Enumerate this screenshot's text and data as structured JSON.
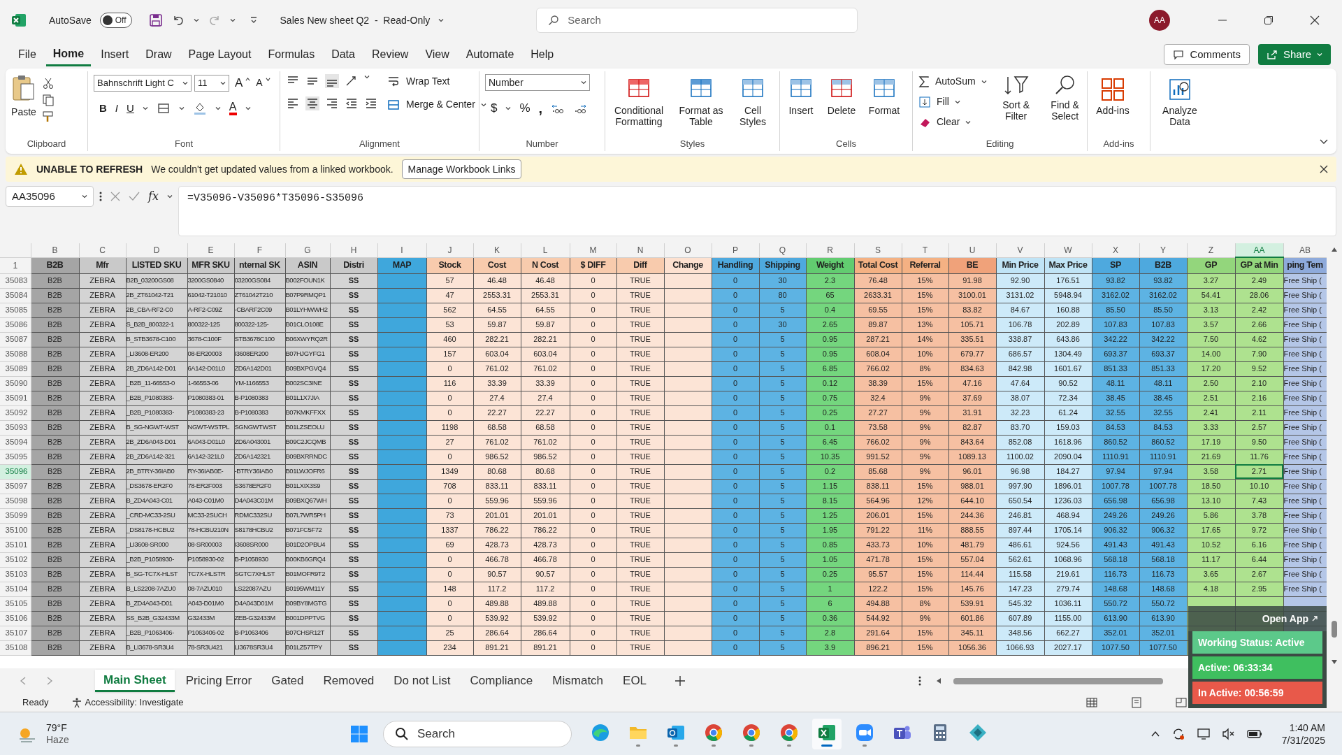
{
  "title_bar": {
    "autosave_label": "AutoSave",
    "autosave": {
      "on": false,
      "label": "Off"
    },
    "document_title": "Sales New sheet Q2  -  Read-Only",
    "search_placeholder": "Search",
    "avatar": "AA"
  },
  "menu_tabs": [
    {
      "label": "File",
      "selected": false
    },
    {
      "label": "Home",
      "selected": true
    },
    {
      "label": "Insert",
      "selected": false
    },
    {
      "label": "Draw",
      "selected": false
    },
    {
      "label": "Page Layout",
      "selected": false
    },
    {
      "label": "Formulas",
      "selected": false
    },
    {
      "label": "Data",
      "selected": false
    },
    {
      "label": "Review",
      "selected": false
    },
    {
      "label": "View",
      "selected": false
    },
    {
      "label": "Automate",
      "selected": false
    },
    {
      "label": "Help",
      "selected": false
    }
  ],
  "comments_button": "Comments",
  "share_button": "Share",
  "ribbon": {
    "clipboard": {
      "paste": "Paste",
      "group": "Clipboard"
    },
    "font": {
      "font_name": "Bahnschrift Light C",
      "font_size": "11",
      "grow": "A",
      "shrink": "A",
      "bold": "B",
      "italic": "I",
      "underline": "U",
      "font_color": "A",
      "group": "Font"
    },
    "alignment": {
      "wrap": "Wrap Text",
      "merge": "Merge & Center",
      "group": "Alignment"
    },
    "number": {
      "format": "Number",
      "currency": "$",
      "percent": "%",
      "comma": ",",
      "group": "Number"
    },
    "styles": {
      "conditional": "Conditional Formatting",
      "table": "Format as Table",
      "cell_styles": "Cell Styles",
      "group": "Styles"
    },
    "cells": {
      "insert": "Insert",
      "delete": "Delete",
      "format": "Format",
      "group": "Cells"
    },
    "editing": {
      "autosum": "AutoSum",
      "fill": "Fill",
      "clear": "Clear",
      "sort": "Sort & Filter",
      "find": "Find & Select",
      "group": "Editing"
    },
    "addins": {
      "addins": "Add-ins",
      "analyze": "Analyze Data",
      "group": "Add-ins"
    }
  },
  "message_bar": {
    "title": "UNABLE TO REFRESH",
    "text": "We couldn't get updated values from a linked workbook.",
    "button": "Manage Workbook Links"
  },
  "formula_bar": {
    "name_box": "AA35096",
    "function_label": "fx",
    "formula": "=V35096-V35096*T35096-S35096"
  },
  "sheet": {
    "columns": [
      {
        "letter": "B",
        "header": "B2B",
        "kind": "key",
        "selected": false
      },
      {
        "letter": "C",
        "header": "Mfr",
        "kind": "info",
        "selected": false
      },
      {
        "letter": "D",
        "header": "LISTED SKU",
        "kind": "info",
        "selected": false
      },
      {
        "letter": "E",
        "header": "MFR SKU",
        "kind": "info",
        "selected": false
      },
      {
        "letter": "F",
        "header": "nternal SK",
        "kind": "info",
        "selected": false
      },
      {
        "letter": "G",
        "header": "ASIN",
        "kind": "info",
        "selected": false
      },
      {
        "letter": "H",
        "header": "Distri",
        "kind": "info",
        "selected": false
      },
      {
        "letter": "I",
        "header": "MAP",
        "kind": "map",
        "selected": false
      },
      {
        "letter": "J",
        "header": "Stock",
        "kind": "cost",
        "selected": false
      },
      {
        "letter": "K",
        "header": "Cost",
        "kind": "cost",
        "selected": false
      },
      {
        "letter": "L",
        "header": "N Cost",
        "kind": "cost",
        "selected": false
      },
      {
        "letter": "M",
        "header": "$ DIFF",
        "kind": "cost",
        "selected": false
      },
      {
        "letter": "N",
        "header": "Diff",
        "kind": "cost",
        "selected": false
      },
      {
        "letter": "O",
        "header": "Change",
        "kind": "change",
        "selected": false
      },
      {
        "letter": "P",
        "header": "Handling",
        "kind": "ship",
        "selected": false
      },
      {
        "letter": "Q",
        "header": "Shipping",
        "kind": "ship",
        "selected": false
      },
      {
        "letter": "R",
        "header": "Weight",
        "kind": "weight",
        "selected": false
      },
      {
        "letter": "S",
        "header": "Total Cost",
        "kind": "total",
        "selected": false
      },
      {
        "letter": "T",
        "header": "Referral",
        "kind": "total",
        "selected": false
      },
      {
        "letter": "U",
        "header": "BE",
        "kind": "be",
        "selected": false
      },
      {
        "letter": "V",
        "header": "Min Price",
        "kind": "price",
        "selected": false
      },
      {
        "letter": "W",
        "header": "Max Price",
        "kind": "price",
        "selected": false
      },
      {
        "letter": "X",
        "header": "SP",
        "kind": "sp",
        "selected": false
      },
      {
        "letter": "Y",
        "header": "B2B",
        "kind": "sp",
        "selected": false
      },
      {
        "letter": "Z",
        "header": "GP",
        "kind": "gp",
        "selected": false
      },
      {
        "letter": "AA",
        "header": "GP at Min",
        "kind": "gp",
        "selected": true
      },
      {
        "letter": "AB",
        "header": "ping Tem",
        "kind": "template",
        "selected": false
      }
    ],
    "header_row_number": "1",
    "rows": [
      {
        "number": "35083",
        "selected": false,
        "cells": [
          "B2B",
          "ZEBRA",
          "B2B_03200GS08",
          "3200GS0840",
          "03200GS084",
          "B002FOUN1K",
          "SS",
          null,
          "57",
          "46.48",
          "46.48",
          "0",
          "TRUE",
          null,
          "0",
          "30",
          "2.3",
          "76.48",
          "15%",
          "91.98",
          "92.90",
          "176.51",
          "93.82",
          "93.82",
          "3.27",
          "2.49",
          "Free Ship ("
        ]
      },
      {
        "number": "35084",
        "selected": false,
        "cells": [
          "B2B",
          "ZEBRA",
          "2B_ZT61042-T21",
          "61042-T21010",
          "ZT61042T210",
          "B07P9RMQP1",
          "SS",
          null,
          "47",
          "2553.31",
          "2553.31",
          "0",
          "TRUE",
          null,
          "0",
          "80",
          "65",
          "2633.31",
          "15%",
          "3100.01",
          "3131.02",
          "5948.94",
          "3162.02",
          "3162.02",
          "54.41",
          "28.06",
          "Free Ship ("
        ]
      },
      {
        "number": "35085",
        "selected": false,
        "cells": [
          "B2B",
          "ZEBRA",
          "2B_CBA-RF2-C0",
          "A-RF2-C09Z",
          "-CBARF2C09",
          "B01LYHWWH2",
          "SS",
          null,
          "562",
          "64.55",
          "64.55",
          "0",
          "TRUE",
          null,
          "0",
          "5",
          "0.4",
          "69.55",
          "15%",
          "83.82",
          "84.67",
          "160.88",
          "85.50",
          "85.50",
          "3.13",
          "2.42",
          "Free Ship ("
        ]
      },
      {
        "number": "35086",
        "selected": false,
        "cells": [
          "B2B",
          "ZEBRA",
          "S_B2B_800322-1",
          "800322-125",
          "800322-125-",
          "B01CLO108E",
          "SS",
          null,
          "53",
          "59.87",
          "59.87",
          "0",
          "TRUE",
          null,
          "0",
          "30",
          "2.65",
          "89.87",
          "13%",
          "105.71",
          "106.78",
          "202.89",
          "107.83",
          "107.83",
          "3.57",
          "2.66",
          "Free Ship ("
        ]
      },
      {
        "number": "35087",
        "selected": false,
        "cells": [
          "B2B",
          "ZEBRA",
          "B_STB3678-C100",
          "3678-C100F",
          "STB3678C100",
          "B06XWYRQ2R",
          "SS",
          null,
          "460",
          "282.21",
          "282.21",
          "0",
          "TRUE",
          null,
          "0",
          "5",
          "0.95",
          "287.21",
          "14%",
          "335.51",
          "338.87",
          "643.86",
          "342.22",
          "342.22",
          "7.50",
          "4.62",
          "Free Ship ("
        ]
      },
      {
        "number": "35088",
        "selected": false,
        "cells": [
          "B2B",
          "ZEBRA",
          "_LI3608-ER200",
          "08-ER20003",
          "I3608ER200",
          "B07HJGYFG1",
          "SS",
          null,
          "157",
          "603.04",
          "603.04",
          "0",
          "TRUE",
          null,
          "0",
          "5",
          "0.95",
          "608.04",
          "10%",
          "679.77",
          "686.57",
          "1304.49",
          "693.37",
          "693.37",
          "14.00",
          "7.90",
          "Free Ship ("
        ]
      },
      {
        "number": "35089",
        "selected": false,
        "cells": [
          "B2B",
          "ZEBRA",
          "2B_ZD6A142-D01",
          "6A142-D01L0",
          "ZD6A142D01",
          "B09BXPGVQ4",
          "SS",
          null,
          "0",
          "761.02",
          "761.02",
          "0",
          "TRUE",
          null,
          "0",
          "5",
          "6.85",
          "766.02",
          "8%",
          "834.63",
          "842.98",
          "1601.67",
          "851.33",
          "851.33",
          "17.20",
          "9.52",
          "Free Ship ("
        ]
      },
      {
        "number": "35090",
        "selected": false,
        "cells": [
          "B2B",
          "ZEBRA",
          "_B2B_11-66553-0",
          "1-66553-06",
          "YM-1166553",
          "B002SC3INE",
          "SS",
          null,
          "116",
          "33.39",
          "33.39",
          "0",
          "TRUE",
          null,
          "0",
          "5",
          "0.12",
          "38.39",
          "15%",
          "47.16",
          "47.64",
          "90.52",
          "48.11",
          "48.11",
          "2.50",
          "2.10",
          "Free Ship ("
        ]
      },
      {
        "number": "35091",
        "selected": false,
        "cells": [
          "B2B",
          "ZEBRA",
          "_B2B_P1080383-",
          "P1080383-01",
          "B-P1080383",
          "B01L1X7JIA",
          "SS",
          null,
          "0",
          "27.4",
          "27.4",
          "0",
          "TRUE",
          null,
          "0",
          "5",
          "0.75",
          "32.4",
          "9%",
          "37.69",
          "38.07",
          "72.34",
          "38.45",
          "38.45",
          "2.51",
          "2.16",
          "Free Ship ("
        ]
      },
      {
        "number": "35092",
        "selected": false,
        "cells": [
          "B2B",
          "ZEBRA",
          "_B2B_P1080383-",
          "P1080383-23",
          "B-P1080383",
          "B07KMKFFXX",
          "SS",
          null,
          "0",
          "22.27",
          "22.27",
          "0",
          "TRUE",
          null,
          "0",
          "5",
          "0.25",
          "27.27",
          "9%",
          "31.91",
          "32.23",
          "61.24",
          "32.55",
          "32.55",
          "2.41",
          "2.11",
          "Free Ship ("
        ]
      },
      {
        "number": "35093",
        "selected": false,
        "cells": [
          "B2B",
          "ZEBRA",
          "B_SG-NGWT-WST",
          "NGWT-WSTPL",
          "SGNGWTWST",
          "B01LZSEOLU",
          "SS",
          null,
          "1198",
          "68.58",
          "68.58",
          "0",
          "TRUE",
          null,
          "0",
          "5",
          "0.1",
          "73.58",
          "9%",
          "82.87",
          "83.70",
          "159.03",
          "84.53",
          "84.53",
          "3.33",
          "2.57",
          "Free Ship ("
        ]
      },
      {
        "number": "35094",
        "selected": false,
        "cells": [
          "B2B",
          "ZEBRA",
          "2B_ZD6A043-D01",
          "6A043-D01L0",
          "ZD6A043001",
          "B09C2JCQMB",
          "SS",
          null,
          "27",
          "761.02",
          "761.02",
          "0",
          "TRUE",
          null,
          "0",
          "5",
          "6.45",
          "766.02",
          "9%",
          "843.64",
          "852.08",
          "1618.96",
          "860.52",
          "860.52",
          "17.19",
          "9.50",
          "Free Ship ("
        ]
      },
      {
        "number": "35095",
        "selected": false,
        "cells": [
          "B2B",
          "ZEBRA",
          "2B_ZD6A142-321",
          "6A142-321L0",
          "ZD6A142321",
          "B09BXRRNDC",
          "SS",
          null,
          "0",
          "986.52",
          "986.52",
          "0",
          "TRUE",
          null,
          "0",
          "5",
          "10.35",
          "991.52",
          "9%",
          "1089.13",
          "1100.02",
          "2090.04",
          "1110.91",
          "1110.91",
          "21.69",
          "11.76",
          "Free Ship ("
        ]
      },
      {
        "number": "35096",
        "selected": true,
        "cells": [
          "B2B",
          "ZEBRA",
          "2B_BTRY-36IAB0",
          "RY-36IAB0E-",
          "-BTRY36IAB0",
          "B01LWJOFR6",
          "SS",
          null,
          "1349",
          "80.68",
          "80.68",
          "0",
          "TRUE",
          null,
          "0",
          "5",
          "0.2",
          "85.68",
          "9%",
          "96.01",
          "96.98",
          "184.27",
          "97.94",
          "97.94",
          "3.58",
          "2.71",
          "Free Ship ("
        ]
      },
      {
        "number": "35097",
        "selected": false,
        "cells": [
          "B2B",
          "ZEBRA",
          "_DS3678-ER2F0",
          "78-ER2F003",
          "S3678ER2F0",
          "B01LXIX3S9",
          "SS",
          null,
          "708",
          "833.11",
          "833.11",
          "0",
          "TRUE",
          null,
          "0",
          "5",
          "1.15",
          "838.11",
          "15%",
          "988.01",
          "997.90",
          "1896.01",
          "1007.78",
          "1007.78",
          "18.50",
          "10.10",
          "Free Ship ("
        ]
      },
      {
        "number": "35098",
        "selected": false,
        "cells": [
          "B2B",
          "ZEBRA",
          "B_ZD4A043-C01",
          "A043-C01M0",
          "D4A043C01M",
          "B09BXQ67WH",
          "SS",
          null,
          "0",
          "559.96",
          "559.96",
          "0",
          "TRUE",
          null,
          "0",
          "5",
          "8.15",
          "564.96",
          "12%",
          "644.10",
          "650.54",
          "1236.03",
          "656.98",
          "656.98",
          "13.10",
          "7.43",
          "Free Ship ("
        ]
      },
      {
        "number": "35099",
        "selected": false,
        "cells": [
          "B2B",
          "ZEBRA",
          "_CRD-MC33-2SU",
          "MC33-2SUCH",
          "RDMC332SU",
          "B07L7WR5PH",
          "SS",
          null,
          "73",
          "201.01",
          "201.01",
          "0",
          "TRUE",
          null,
          "0",
          "5",
          "1.25",
          "206.01",
          "15%",
          "244.36",
          "246.81",
          "468.94",
          "249.26",
          "249.26",
          "5.86",
          "3.78",
          "Free Ship ("
        ]
      },
      {
        "number": "35100",
        "selected": false,
        "cells": [
          "B2B",
          "ZEBRA",
          "_DS8178-HCBU2",
          "78-HCBU210N",
          "S8178HCBU2",
          "B071FC5F72",
          "SS",
          null,
          "1337",
          "786.22",
          "786.22",
          "0",
          "TRUE",
          null,
          "0",
          "5",
          "1.95",
          "791.22",
          "11%",
          "888.55",
          "897.44",
          "1705.14",
          "906.32",
          "906.32",
          "17.65",
          "9.72",
          "Free Ship ("
        ]
      },
      {
        "number": "35101",
        "selected": false,
        "cells": [
          "B2B",
          "ZEBRA",
          "_LI3608-SR000",
          "08-SR00003",
          "I3608SR000",
          "B01D2OPBU4",
          "SS",
          null,
          "69",
          "428.73",
          "428.73",
          "0",
          "TRUE",
          null,
          "0",
          "5",
          "0.85",
          "433.73",
          "10%",
          "481.79",
          "486.61",
          "924.56",
          "491.43",
          "491.43",
          "10.52",
          "6.16",
          "Free Ship ("
        ]
      },
      {
        "number": "35102",
        "selected": false,
        "cells": [
          "B2B",
          "ZEBRA",
          "_B2B_P1058930-",
          "P1058930-02",
          "B-P1058930",
          "B00KB6GRQ4",
          "SS",
          null,
          "0",
          "466.78",
          "466.78",
          "0",
          "TRUE",
          null,
          "0",
          "5",
          "1.05",
          "471.78",
          "15%",
          "557.04",
          "562.61",
          "1068.96",
          "568.18",
          "568.18",
          "11.17",
          "6.44",
          "Free Ship ("
        ]
      },
      {
        "number": "35103",
        "selected": false,
        "cells": [
          "B2B",
          "ZEBRA",
          "B_SG-TC7X-HLST",
          "TC7X-HLSTR",
          "SGTC7XHLST",
          "B01MOFR9T2",
          "SS",
          null,
          "0",
          "90.57",
          "90.57",
          "0",
          "TRUE",
          null,
          "0",
          "5",
          "0.25",
          "95.57",
          "15%",
          "114.44",
          "115.58",
          "219.61",
          "116.73",
          "116.73",
          "3.65",
          "2.67",
          "Free Ship ("
        ]
      },
      {
        "number": "35104",
        "selected": false,
        "cells": [
          "B2B",
          "ZEBRA",
          "B_LS2208-7AZU0",
          "08-7AZU010",
          "LS22087AZU",
          "B0195WM11Y",
          "SS",
          null,
          "148",
          "117.2",
          "117.2",
          "0",
          "TRUE",
          null,
          "0",
          "5",
          "1",
          "122.2",
          "15%",
          "145.76",
          "147.23",
          "279.74",
          "148.68",
          "148.68",
          "4.18",
          "2.95",
          "Free Ship ("
        ]
      },
      {
        "number": "35105",
        "selected": false,
        "cells": [
          "B2B",
          "ZEBRA",
          "B_ZD4A043-D01",
          "A043-D01M0",
          "D4A043D01M",
          "B09BY8MGTG",
          "SS",
          null,
          "0",
          "489.88",
          "489.88",
          "0",
          "TRUE",
          null,
          "0",
          "5",
          "6",
          "494.88",
          "8%",
          "539.91",
          "545.32",
          "1036.11",
          "550.72",
          "550.72"
        ]
      },
      {
        "number": "35106",
        "selected": false,
        "cells": [
          "B2B",
          "ZEBRA",
          "SS_B2B_G32433M",
          "G32433M",
          "ZEB-G32433M",
          "B001DPPTVG",
          "SS",
          null,
          "0",
          "539.92",
          "539.92",
          "0",
          "TRUE",
          null,
          "0",
          "5",
          "0.36",
          "544.92",
          "9%",
          "601.86",
          "607.89",
          "1155.00",
          "613.90",
          "613.90"
        ]
      },
      {
        "number": "35107",
        "selected": false,
        "cells": [
          "B2B",
          "ZEBRA",
          "_B2B_P1063406-",
          "P1063406-02",
          "B-P1063406",
          "B07CHSR12T",
          "SS",
          null,
          "25",
          "286.64",
          "286.64",
          "0",
          "TRUE",
          null,
          "0",
          "5",
          "2.8",
          "291.64",
          "15%",
          "345.11",
          "348.56",
          "662.27",
          "352.01",
          "352.01"
        ]
      },
      {
        "number": "35108",
        "selected": false,
        "cells": [
          "B2B",
          "ZEBRA",
          "B_LI3678-SR3U4",
          "78-SR3U421",
          "LI3678SR3U4",
          "B01LZ57TPY",
          "SS",
          null,
          "234",
          "891.21",
          "891.21",
          "0",
          "TRUE",
          null,
          "0",
          "5",
          "3.9",
          "896.21",
          "15%",
          "1056.36",
          "1066.93",
          "2027.17",
          "1077.50",
          "1077.50"
        ]
      }
    ]
  },
  "sheet_tabs": [
    {
      "label": "Main Sheet",
      "selected": true
    },
    {
      "label": "Pricing Error",
      "selected": false
    },
    {
      "label": "Gated",
      "selected": false
    },
    {
      "label": "Removed",
      "selected": false
    },
    {
      "label": "Do not List",
      "selected": false
    },
    {
      "label": "Compliance",
      "selected": false
    },
    {
      "label": "Mismatch",
      "selected": false
    },
    {
      "label": "EOL",
      "selected": false
    }
  ],
  "status_bar": {
    "mode": "Ready",
    "accessibility": "Accessibility: Investigate"
  },
  "time_tracker": {
    "open_app": "Open App",
    "status": "Working Status: Active",
    "active": "Active: 06:33:34",
    "inactive": "In Active: 00:56:59"
  },
  "taskbar": {
    "temperature": "79°F",
    "condition": "Haze",
    "search_placeholder": "Search",
    "time": "1:40 AM",
    "date": "7/31/2025",
    "apps": [
      {
        "kind": "edge",
        "running": false,
        "selected": false
      },
      {
        "kind": "folder",
        "running": true,
        "selected": false
      },
      {
        "kind": "mail",
        "running": true,
        "selected": false
      },
      {
        "kind": "chrome",
        "running": true,
        "selected": false
      },
      {
        "kind": "chrome",
        "running": true,
        "selected": false
      },
      {
        "kind": "chrome",
        "running": true,
        "selected": false
      },
      {
        "kind": "excel",
        "running": true,
        "selected": true
      },
      {
        "kind": "video",
        "running": true,
        "selected": false
      },
      {
        "kind": "teams",
        "running": false,
        "selected": false
      },
      {
        "kind": "calculator",
        "running": false,
        "selected": false
      },
      {
        "kind": "diamond",
        "running": false,
        "selected": false
      }
    ]
  }
}
